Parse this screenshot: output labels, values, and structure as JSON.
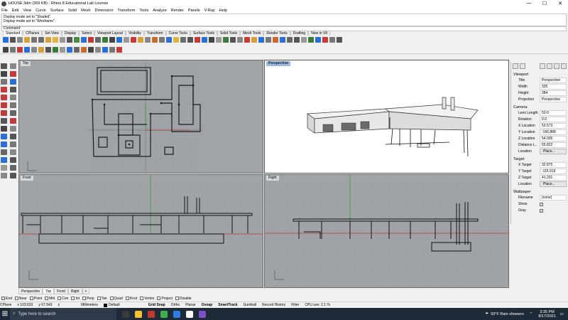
{
  "window": {
    "title": "HOUSE.3dm (369 KB) - Rhino 8 Educational Lab License",
    "min": "—",
    "max": "☐",
    "close": "✕"
  },
  "menu": [
    "File",
    "Edit",
    "View",
    "Curve",
    "Surface",
    "Solid",
    "Mesh",
    "Dimension",
    "Transform",
    "Tools",
    "Analyze",
    "Render",
    "Panels",
    "V-Ray",
    "Help"
  ],
  "history": [
    "Display mode set to \"Shaded\".",
    "Display mode set to \"Wireframe\"."
  ],
  "command": {
    "label": "Command:"
  },
  "toolbar_tabs": [
    "Standard",
    "CPlanes",
    "Set View",
    "Display",
    "Select",
    "Viewport Layout",
    "Visibility",
    "Transform",
    "Curve Tools",
    "Surface Tools",
    "Solid Tools",
    "Mesh Tools",
    "Render Tools",
    "Drafting",
    "New in V8"
  ],
  "toolbar_tab_active": "Standard",
  "toolbar_row1_colors": [
    "#2a6fd6",
    "#555",
    "#888",
    "#d2a13b",
    "#777",
    "#6b6b6b",
    "#d2a13b",
    "#e0b545",
    "#999",
    "#555",
    "#4e8a3c",
    "#2a6fd6",
    "#c23a3a",
    "#666",
    "#3a7a3a",
    "#444",
    "#2a6fd6",
    "#999",
    "#c23a3a",
    "#d2a13b",
    "#888",
    "#c46c2f",
    "#777",
    "#2a6fd6",
    "#e0b545",
    "#6b6b6b",
    "#555",
    "#c23a3a",
    "#2a6fd6",
    "#444",
    "#999",
    "#3a7a3a",
    "#555",
    "#888",
    "#c23a3a",
    "#d2a13b",
    "#2a6fd6",
    "#777",
    "#c46c2f",
    "#2a6fd6",
    "#666",
    "#555",
    "#999",
    "#3a7a3a",
    "#2a6fd6",
    "#c23a3a",
    "#777",
    "#555"
  ],
  "toolbar_row2_colors": [
    "#444",
    "#777",
    "#c23a3a",
    "#2a6fd6",
    "#888",
    "#d2a13b",
    "#555",
    "#3a7a3a",
    "#999",
    "#2a6fd6",
    "#666",
    "#c46c2f",
    "#444",
    "#888",
    "#2a6fd6",
    "#777",
    "#c23a3a"
  ],
  "left_tool_colors": [
    "#555",
    "#888",
    "#444",
    "#c23a3a",
    "#777",
    "#2a6fd6",
    "#c23a3a",
    "#555",
    "#c23a3a",
    "#888",
    "#c23a3a",
    "#777",
    "#c23a3a",
    "#666",
    "#555",
    "#c23a3a",
    "#444",
    "#888",
    "#2a6fd6",
    "#555",
    "#2a6fd6",
    "#777",
    "#666",
    "#888",
    "#2a6fd6",
    "#555",
    "#999",
    "#666",
    "#888",
    "#555"
  ],
  "viewports": {
    "top": "Top",
    "perspective": "Perspective",
    "front": "Front",
    "right": "Right"
  },
  "viewport_tabs": [
    "Perspective",
    "Top",
    "Front",
    "Right",
    "+"
  ],
  "viewport_tab_active": "Top",
  "panel": {
    "viewport_heading": "Viewport",
    "title_k": "Title",
    "title_v": "Perspective",
    "width_k": "Width",
    "width_v": "325",
    "height_k": "Height",
    "height_v": "384",
    "projection_k": "Projection",
    "projection_v": "Perspective",
    "camera_heading": "Camera",
    "lens_k": "Lens Length",
    "lens_v": "50.0",
    "rotation_k": "Rotation",
    "rotation_v": "0.0",
    "xloc_k": "X Location",
    "xloc_v": "53.573",
    "yloc_k": "Y Location",
    "yloc_v": "-166.888",
    "zloc_k": "Z Location",
    "zloc_v": "54.036",
    "dist_k": "Distance t...",
    "dist_v": "55.822",
    "location_k": "Location",
    "location_btn": "Place...",
    "target_heading": "Target",
    "xtar_k": "X Target",
    "xtar_v": "32.875",
    "ytar_k": "Y Target",
    "ytar_v": "-115.919",
    "ztar_k": "Z Target",
    "ztar_v": "41.201",
    "tlocation_k": "Location",
    "tlocation_btn": "Place...",
    "wallpaper_heading": "Wallpaper",
    "filename_k": "Filename",
    "filename_v": "(none)",
    "show_k": "Show",
    "gray_k": "Gray"
  },
  "osnaps": [
    {
      "label": "End",
      "on": true
    },
    {
      "label": "Near",
      "on": false
    },
    {
      "label": "Point",
      "on": false
    },
    {
      "label": "Mid",
      "on": false
    },
    {
      "label": "Cen",
      "on": false
    },
    {
      "label": "Int",
      "on": false
    },
    {
      "label": "Perp",
      "on": false
    },
    {
      "label": "Tan",
      "on": false
    },
    {
      "label": "Quad",
      "on": false
    },
    {
      "label": "Knot",
      "on": false
    },
    {
      "label": "Vertex",
      "on": false
    },
    {
      "label": "Project",
      "on": false
    },
    {
      "label": "Disable",
      "on": false
    }
  ],
  "status": {
    "cplane": "CPlane",
    "x": "x 103.633",
    "y": "y 67.543",
    "z": "z",
    "units": "Millimeters",
    "layer": "Default",
    "grid_snap": "Grid Snap",
    "ortho": "Ortho",
    "planar": "Planar",
    "osnap": "Osnap",
    "smarttrack": "SmartTrack",
    "gumball": "Gumball",
    "record_history": "Record History",
    "filter": "Filter",
    "cpu": "CPU use: 2.1 %"
  },
  "taskbar": {
    "search_placeholder": "Type here to search",
    "weather": "93°F  Rain showers",
    "time": "3:35 PM",
    "date": "8/17/2021",
    "app_colors": [
      "#3a3a3a",
      "#f2c230",
      "#c0392b",
      "#3daf4a",
      "#2a7de1",
      "#ffffff",
      "#7b4fc9"
    ]
  }
}
